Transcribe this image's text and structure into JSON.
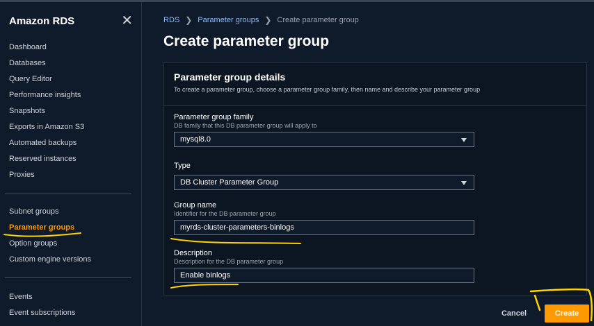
{
  "sidebar": {
    "title": "Amazon RDS",
    "group1": [
      {
        "label": "Dashboard"
      },
      {
        "label": "Databases"
      },
      {
        "label": "Query Editor"
      },
      {
        "label": "Performance insights"
      },
      {
        "label": "Snapshots"
      },
      {
        "label": "Exports in Amazon S3"
      },
      {
        "label": "Automated backups"
      },
      {
        "label": "Reserved instances"
      },
      {
        "label": "Proxies"
      }
    ],
    "group2": [
      {
        "label": "Subnet groups"
      },
      {
        "label": "Parameter groups"
      },
      {
        "label": "Option groups"
      },
      {
        "label": "Custom engine versions"
      }
    ],
    "group3": [
      {
        "label": "Events"
      },
      {
        "label": "Event subscriptions"
      }
    ],
    "active_item": "Parameter groups"
  },
  "breadcrumb": {
    "items": [
      "RDS",
      "Parameter groups",
      "Create parameter group"
    ]
  },
  "page": {
    "title": "Create parameter group"
  },
  "panel": {
    "title": "Parameter group details",
    "description": "To create a parameter group, choose a parameter group family, then name and describe your parameter group",
    "fields": {
      "family": {
        "label": "Parameter group family",
        "hint": "DB family that this DB parameter group will apply to",
        "value": "mysql8.0"
      },
      "type": {
        "label": "Type",
        "value": "DB Cluster Parameter Group"
      },
      "group_name": {
        "label": "Group name",
        "hint": "Identifier for the DB parameter group",
        "value": "myrds-cluster-parameters-binlogs"
      },
      "description": {
        "label": "Description",
        "hint": "Description for the DB parameter group",
        "value": "Enable binlogs"
      }
    }
  },
  "actions": {
    "cancel_label": "Cancel",
    "create_label": "Create"
  },
  "colors": {
    "accent": "#ff9900",
    "link": "#89bdff",
    "annotation": "#ffd400"
  }
}
